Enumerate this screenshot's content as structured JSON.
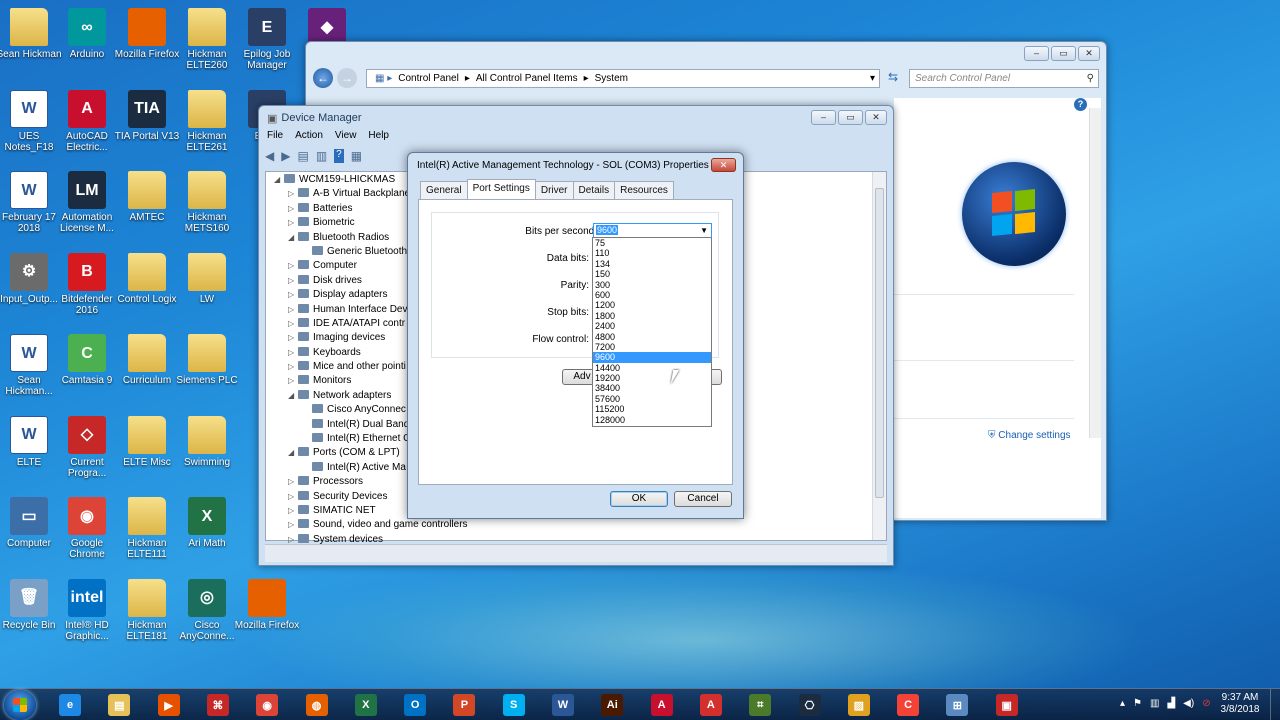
{
  "desktop_icons": [
    {
      "label": "Sean Hickman",
      "glyph": "",
      "kind": "folder"
    },
    {
      "label": "Arduino",
      "glyph": "∞",
      "color": "#00979d"
    },
    {
      "label": "Mozilla Firefox",
      "glyph": "",
      "color": "#e66000"
    },
    {
      "label": "Hickman ELTE260",
      "glyph": "",
      "kind": "folder"
    },
    {
      "label": "Epilog Job Manager",
      "glyph": "E",
      "color": "#2a3f66"
    },
    {
      "label": "",
      "glyph": "◆",
      "color": "#68217a"
    },
    {
      "label": "UES Notes_F18",
      "glyph": "W",
      "kind": "word"
    },
    {
      "label": "AutoCAD Electric...",
      "glyph": "A",
      "color": "#c8102e"
    },
    {
      "label": "TIA Portal V13",
      "glyph": "TIA",
      "color": "#1b2c40"
    },
    {
      "label": "Hickman ELTE261",
      "glyph": "",
      "kind": "folder"
    },
    {
      "label": "Ex Te",
      "glyph": "",
      "color": "#2a3f66"
    },
    {
      "label": "February 17 2018",
      "glyph": "W",
      "kind": "word"
    },
    {
      "label": "Automation License M...",
      "glyph": "LM",
      "color": "#1b2c40"
    },
    {
      "label": "AMTEC",
      "glyph": "",
      "kind": "folder"
    },
    {
      "label": "Hickman METS160",
      "glyph": "",
      "kind": "folder"
    },
    {
      "label": "Input_Outp...",
      "glyph": "⚙",
      "color": "#6b6b6b"
    },
    {
      "label": "Bitdefender 2016",
      "glyph": "B",
      "color": "#d71920"
    },
    {
      "label": "Control Logix",
      "glyph": "",
      "kind": "folder"
    },
    {
      "label": "LW",
      "glyph": "",
      "kind": "folder"
    },
    {
      "label": "Sean Hickman...",
      "glyph": "W",
      "kind": "word"
    },
    {
      "label": "Camtasia 9",
      "glyph": "C",
      "color": "#4caf50"
    },
    {
      "label": "Curriculum",
      "glyph": "",
      "kind": "folder"
    },
    {
      "label": "Siemens PLC",
      "glyph": "",
      "kind": "folder"
    },
    {
      "label": "ELTE",
      "glyph": "W",
      "kind": "word"
    },
    {
      "label": "Current Progra...",
      "glyph": "◇",
      "color": "#c62828"
    },
    {
      "label": "ELTE Misc",
      "glyph": "",
      "kind": "folder"
    },
    {
      "label": "Swimming",
      "glyph": "",
      "kind": "folder"
    },
    {
      "label": "Computer",
      "glyph": "▭",
      "color": "#3c6ea8"
    },
    {
      "label": "Google Chrome",
      "glyph": "◉",
      "color": "#db4437"
    },
    {
      "label": "Hickman ELTE111",
      "glyph": "",
      "kind": "folder"
    },
    {
      "label": "Ari Math",
      "glyph": "X",
      "color": "#217346"
    },
    {
      "label": "Recycle Bin",
      "glyph": "🗑",
      "color": "#7aa0c8"
    },
    {
      "label": "Intel® HD Graphic...",
      "glyph": "intel",
      "color": "#0071c5"
    },
    {
      "label": "Hickman ELTE181",
      "glyph": "",
      "kind": "folder"
    },
    {
      "label": "Cisco AnyConne...",
      "glyph": "◎",
      "color": "#1b6e5b"
    },
    {
      "label": "Mozilla Firefox",
      "glyph": "",
      "color": "#e66000"
    }
  ],
  "control_panel": {
    "breadcrumb": [
      "Control Panel",
      "All Control Panel Items",
      "System"
    ],
    "search_placeholder": "Search Control Panel",
    "change_settings": "Change settings"
  },
  "device_manager": {
    "title": "Device Manager",
    "menu": [
      "File",
      "Action",
      "View",
      "Help"
    ],
    "root": "WCM159-LHICKMAS",
    "tree": [
      {
        "label": "A-B Virtual Backplane",
        "level": 1,
        "toggle": "▷"
      },
      {
        "label": "Batteries",
        "level": 1,
        "toggle": "▷"
      },
      {
        "label": "Biometric",
        "level": 1,
        "toggle": "▷"
      },
      {
        "label": "Bluetooth Radios",
        "level": 1,
        "toggle": "◢"
      },
      {
        "label": "Generic Bluetooth",
        "level": 2,
        "toggle": ""
      },
      {
        "label": "Computer",
        "level": 1,
        "toggle": "▷"
      },
      {
        "label": "Disk drives",
        "level": 1,
        "toggle": "▷"
      },
      {
        "label": "Display adapters",
        "level": 1,
        "toggle": "▷"
      },
      {
        "label": "Human Interface Devi",
        "level": 1,
        "toggle": "▷"
      },
      {
        "label": "IDE ATA/ATAPI contr",
        "level": 1,
        "toggle": "▷"
      },
      {
        "label": "Imaging devices",
        "level": 1,
        "toggle": "▷"
      },
      {
        "label": "Keyboards",
        "level": 1,
        "toggle": "▷"
      },
      {
        "label": "Mice and other pointi",
        "level": 1,
        "toggle": "▷"
      },
      {
        "label": "Monitors",
        "level": 1,
        "toggle": "▷"
      },
      {
        "label": "Network adapters",
        "level": 1,
        "toggle": "◢"
      },
      {
        "label": "Cisco AnyConnec",
        "level": 2,
        "toggle": ""
      },
      {
        "label": "Intel(R) Dual Band",
        "level": 2,
        "toggle": ""
      },
      {
        "label": "Intel(R) Ethernet C",
        "level": 2,
        "toggle": ""
      },
      {
        "label": "Ports (COM & LPT)",
        "level": 1,
        "toggle": "◢"
      },
      {
        "label": "Intel(R) Active Ma",
        "level": 2,
        "toggle": ""
      },
      {
        "label": "Processors",
        "level": 1,
        "toggle": "▷"
      },
      {
        "label": "Security Devices",
        "level": 1,
        "toggle": "▷"
      },
      {
        "label": "SIMATIC NET",
        "level": 1,
        "toggle": "▷"
      },
      {
        "label": "Sound, video and game controllers",
        "level": 1,
        "toggle": "▷"
      },
      {
        "label": "System devices",
        "level": 1,
        "toggle": "▷"
      }
    ]
  },
  "dialog": {
    "title": "Intel(R) Active Management Technology - SOL (COM3) Properties",
    "close": "✕",
    "tabs": [
      "General",
      "Port Settings",
      "Driver",
      "Details",
      "Resources"
    ],
    "active_tab": "Port Settings",
    "fields": [
      "Bits per second:",
      "Data bits:",
      "Parity:",
      "Stop bits:",
      "Flow control:"
    ],
    "bits_per_second": "9600",
    "options": [
      "75",
      "110",
      "134",
      "150",
      "300",
      "600",
      "1200",
      "1800",
      "2400",
      "4800",
      "7200",
      "9600",
      "14400",
      "19200",
      "38400",
      "57600",
      "115200",
      "128000"
    ],
    "selected_option": "9600",
    "advanced_label": "Adv",
    "restore_label": "s",
    "ok": "OK",
    "cancel": "Cancel"
  },
  "taskbar": {
    "apps": [
      {
        "name": "ie",
        "glyph": "e",
        "color": "#1e88e5"
      },
      {
        "name": "explorer",
        "glyph": "▤",
        "color": "#e6c15a"
      },
      {
        "name": "media",
        "glyph": "▶",
        "color": "#e65100"
      },
      {
        "name": "acrobat",
        "glyph": "⌘",
        "color": "#c62828"
      },
      {
        "name": "chrome",
        "glyph": "◉",
        "color": "#db4437"
      },
      {
        "name": "firefox",
        "glyph": "◍",
        "color": "#e66000"
      },
      {
        "name": "excel",
        "glyph": "X",
        "color": "#217346"
      },
      {
        "name": "outlook",
        "glyph": "O",
        "color": "#0072c6"
      },
      {
        "name": "powerpoint",
        "glyph": "P",
        "color": "#d24726"
      },
      {
        "name": "skype",
        "glyph": "S",
        "color": "#00aff0"
      },
      {
        "name": "word",
        "glyph": "W",
        "color": "#2b5797"
      },
      {
        "name": "illustrator",
        "glyph": "Ai",
        "color": "#4a1a00"
      },
      {
        "name": "autocad",
        "glyph": "A",
        "color": "#c8102e"
      },
      {
        "name": "autocad2",
        "glyph": "A",
        "color": "#d32f2f"
      },
      {
        "name": "tia",
        "glyph": "⌗",
        "color": "#4a7a2a"
      },
      {
        "name": "network",
        "glyph": "⎔",
        "color": "#1b2c40"
      },
      {
        "name": "draw",
        "glyph": "▨",
        "color": "#e0a020"
      },
      {
        "name": "camtasia",
        "glyph": "C",
        "color": "#f44336"
      },
      {
        "name": "devices",
        "glyph": "⊞",
        "color": "#5a8ac0"
      },
      {
        "name": "toolbox",
        "glyph": "▣",
        "color": "#c62828"
      }
    ],
    "time": "9:37 AM",
    "date": "3/8/2018"
  }
}
